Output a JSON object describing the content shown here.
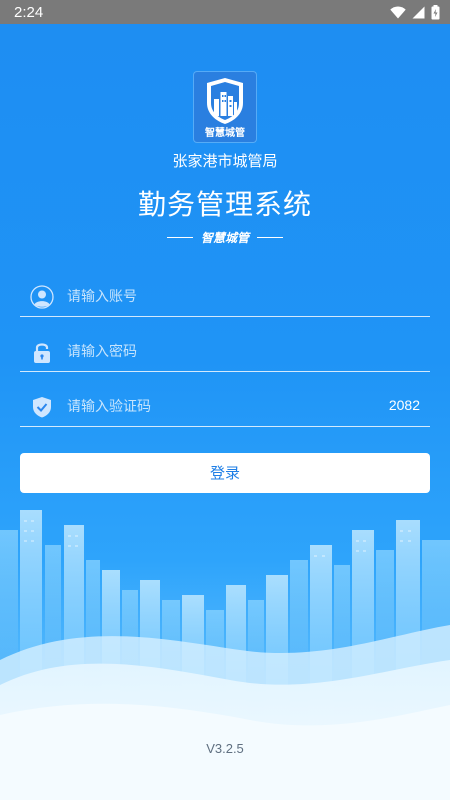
{
  "status_bar": {
    "time": "2:24",
    "icons": [
      "wifi-icon",
      "signal-icon",
      "battery-icon"
    ]
  },
  "logo": {
    "caption": "智慧城管"
  },
  "header": {
    "org_name": "张家港市城管局",
    "app_title": "勤务管理系统",
    "slogan": "智慧城管"
  },
  "form": {
    "account": {
      "placeholder": "请输入账号",
      "value": "",
      "icon": "user-icon"
    },
    "password": {
      "placeholder": "请输入密码",
      "value": "",
      "icon": "lock-icon"
    },
    "captcha": {
      "placeholder": "请输入验证码",
      "value": "",
      "icon": "shield-icon",
      "code": "2082"
    },
    "login_label": "登录"
  },
  "footer": {
    "version": "V3.2.5"
  },
  "colors": {
    "background_top": "#1e8df2",
    "background_bottom": "#7fd0ff",
    "status_bar": "#7a7a7a",
    "button_text": "#1f7fe6",
    "version_text": "#5f6f80"
  }
}
